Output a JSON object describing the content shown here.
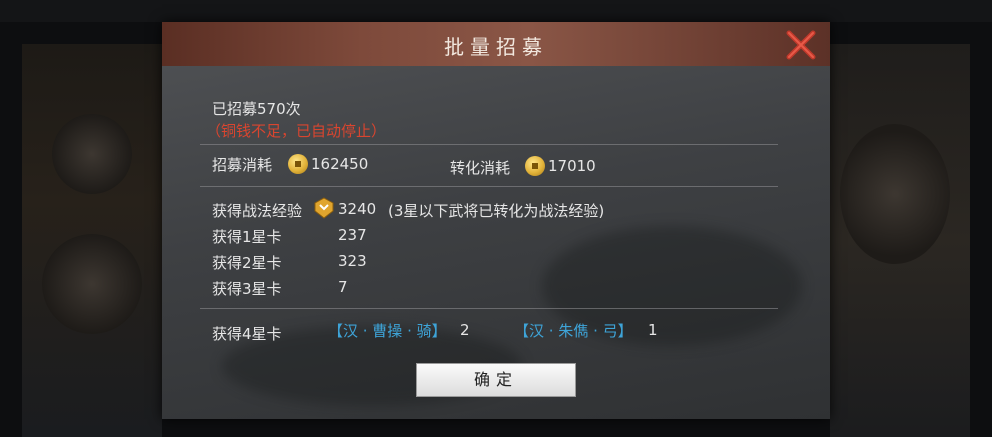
{
  "dialog": {
    "title": "批量招募",
    "recruited_count": "已招募570次",
    "stopped_notice": "（铜钱不足，已自动停止）",
    "cost_label": "招募消耗",
    "cost_value": "162450",
    "convert_label": "转化消耗",
    "convert_value": "17010",
    "exp_label": "获得战法经验",
    "exp_value": "3240",
    "exp_note": "(3星以下武将已转化为战法经验)",
    "cards": [
      {
        "label": "获得1星卡",
        "value": "237"
      },
      {
        "label": "获得2星卡",
        "value": "323"
      },
      {
        "label": "获得3星卡",
        "value": "7"
      }
    ],
    "four_star_label": "获得4星卡",
    "four_star_cards": [
      {
        "name": "【汉 · 曹操 · 骑】",
        "count": "2"
      },
      {
        "name": "【汉 · 朱儁 · 弓】",
        "count": "1"
      }
    ],
    "confirm_label": "确定"
  },
  "colors": {
    "warning": "#d9452f",
    "card_name": "#3ea4d8",
    "title_bar": "#7e4a3b",
    "close": "#c0392b"
  },
  "icons": [
    "close-icon",
    "copper-coin-icon",
    "tactic-exp-icon"
  ]
}
